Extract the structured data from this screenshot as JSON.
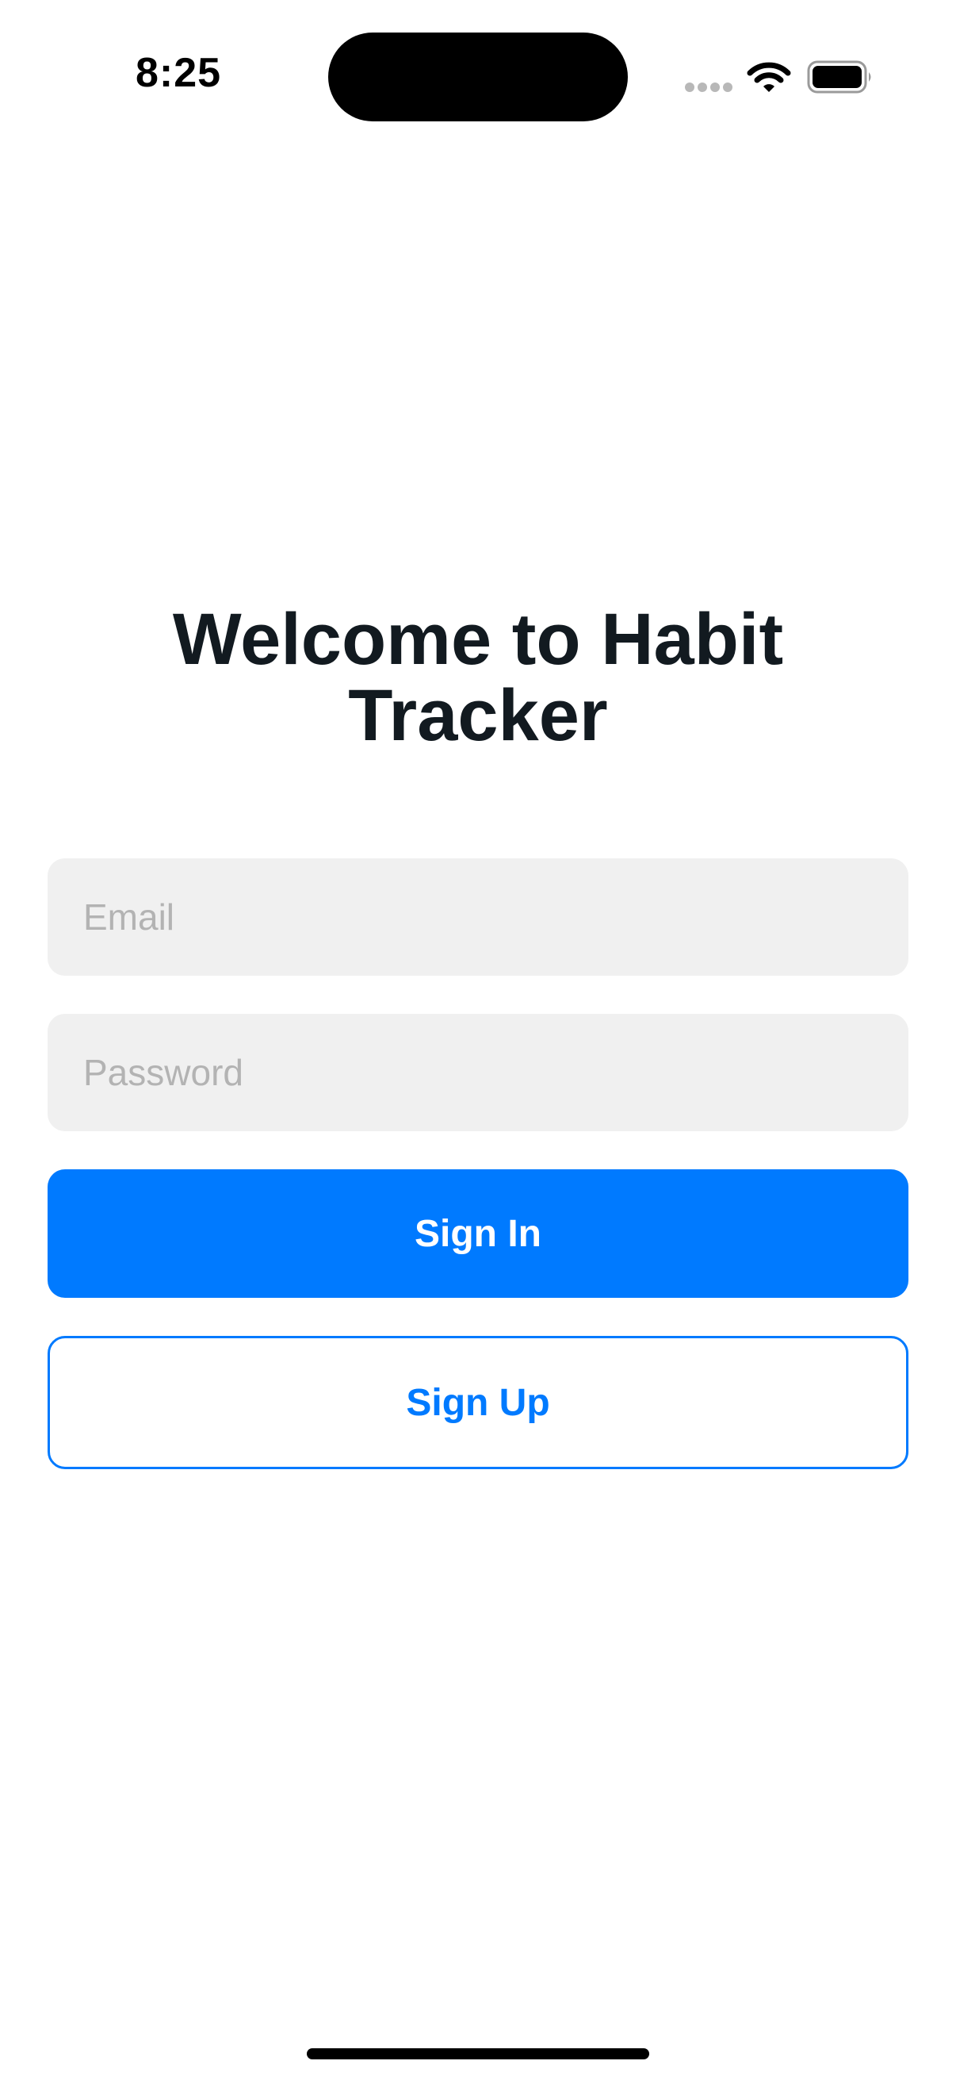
{
  "status_bar": {
    "time": "8:25",
    "icons": [
      "cellular-dots-icon",
      "wifi-icon",
      "battery-icon"
    ]
  },
  "title": "Welcome to Habit Tracker",
  "form": {
    "email_placeholder": "Email",
    "password_placeholder": "Password",
    "sign_in_label": "Sign In",
    "sign_up_label": "Sign Up"
  },
  "colors": {
    "accent": "#007aff",
    "field_background": "#f0f0f0",
    "placeholder": "#b3b3b3",
    "title_text": "#121a20"
  }
}
